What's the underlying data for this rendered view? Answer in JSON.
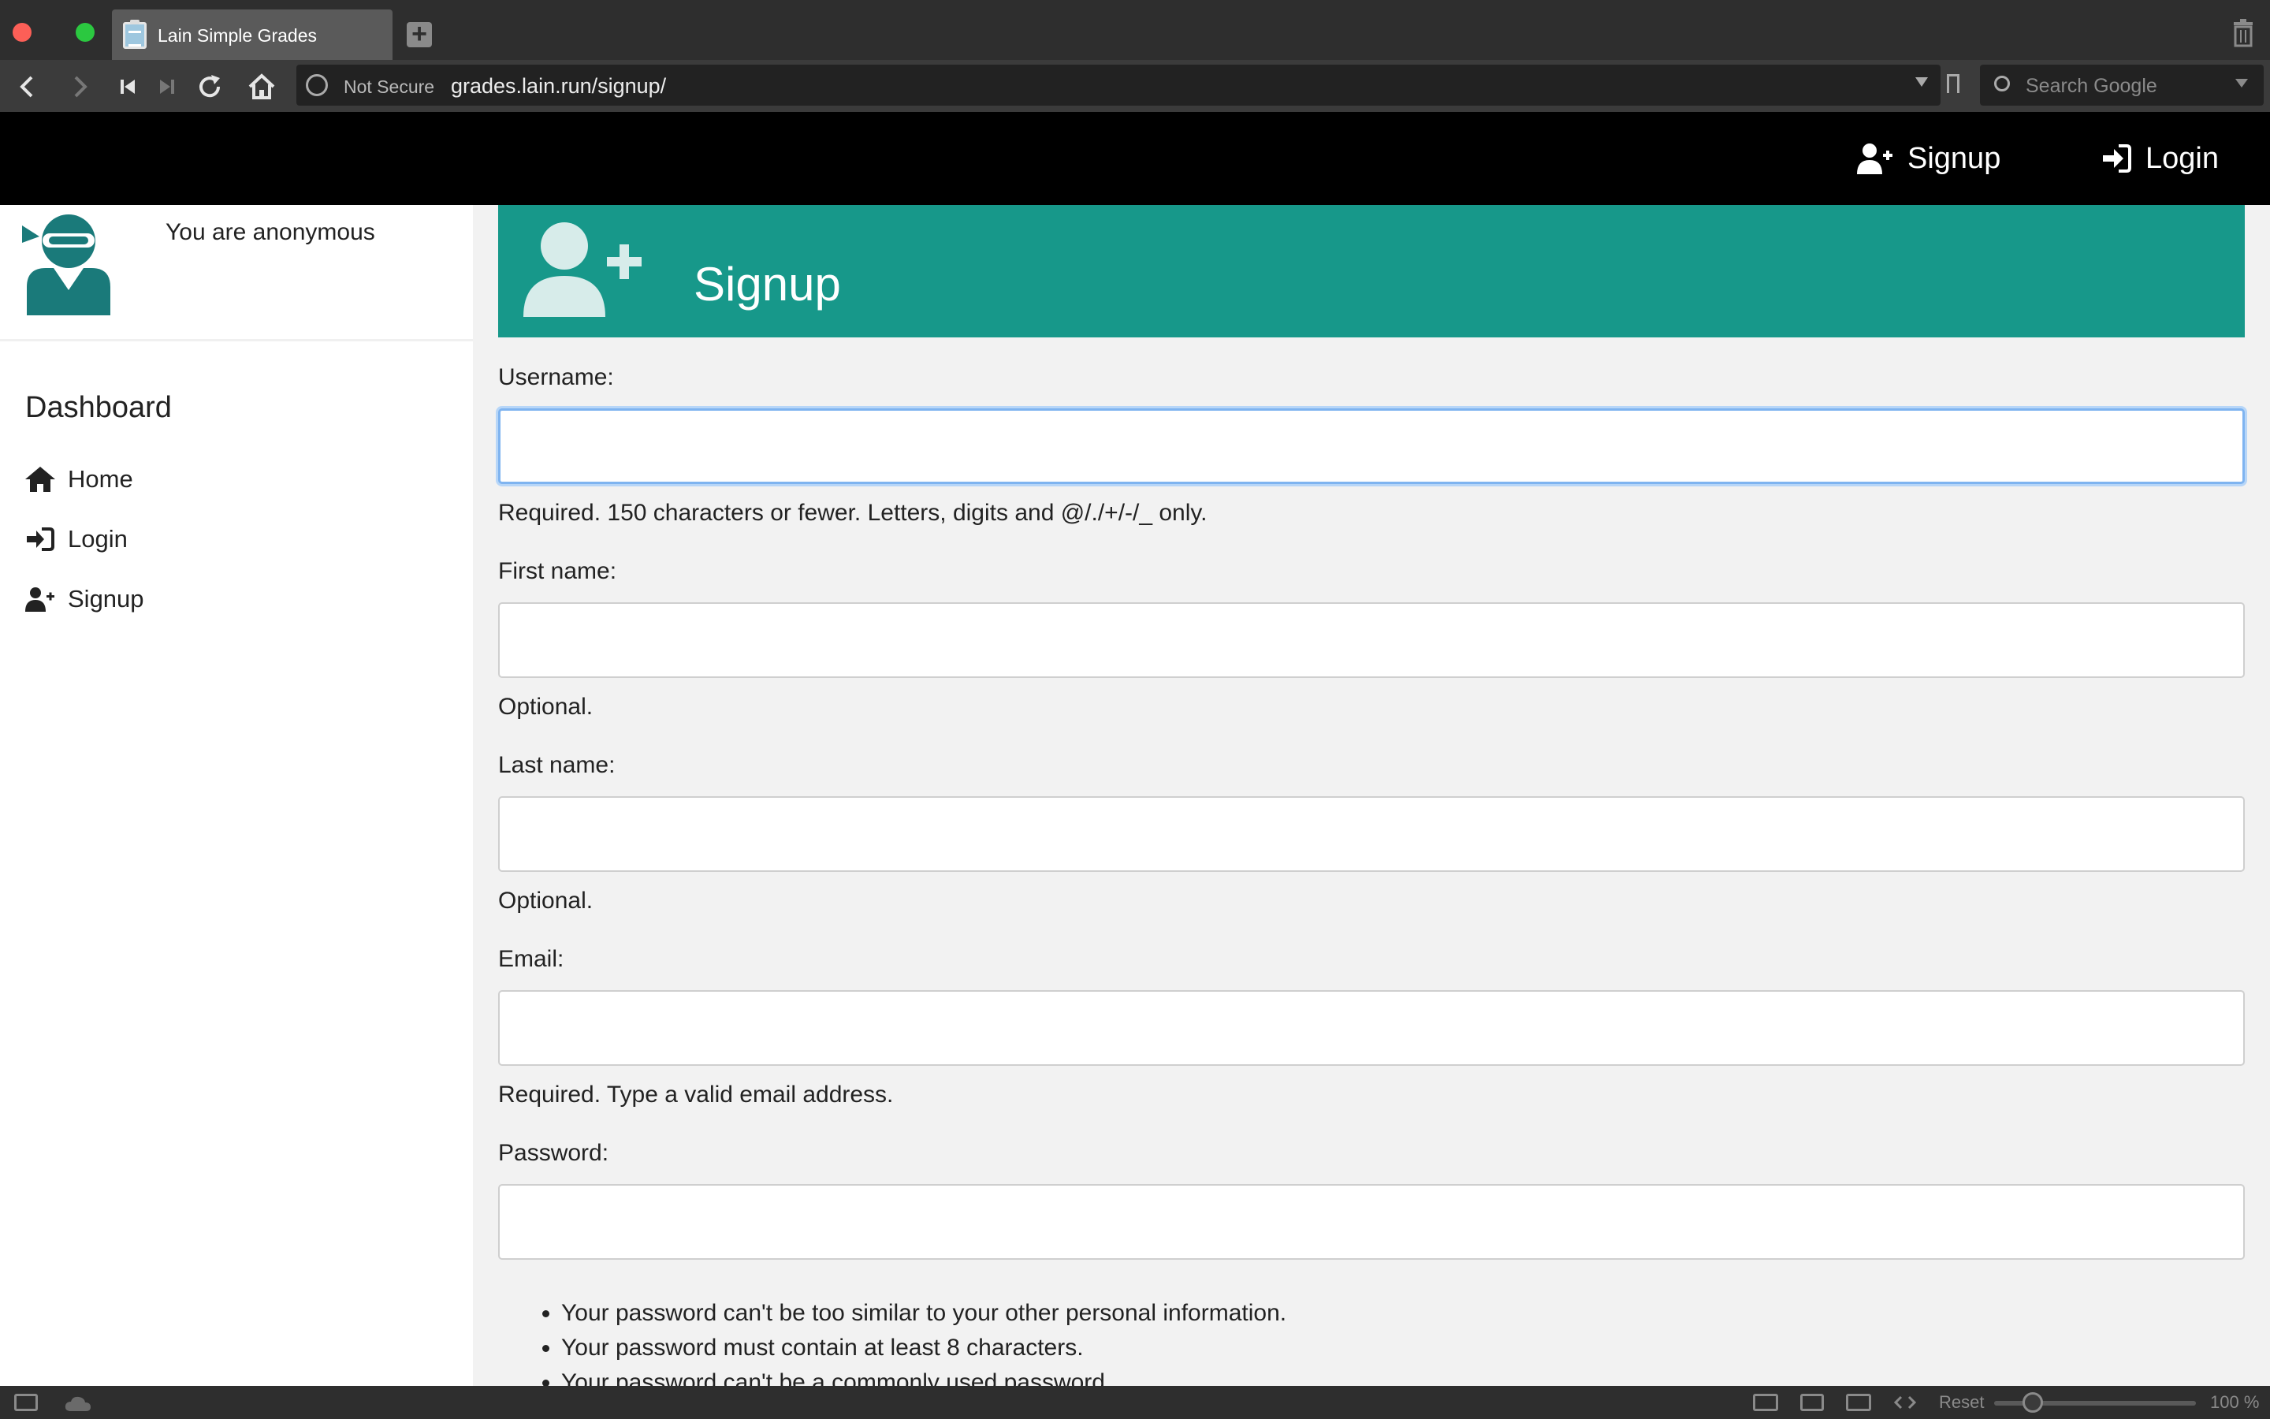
{
  "browser": {
    "tab_title": "Lain Simple Grades",
    "new_tab_label": "+",
    "security_label": "Not Secure",
    "url": "grades.lain.run/signup/",
    "search_placeholder": "Search Google",
    "zoom_reset_label": "Reset",
    "zoom_level": "100 %"
  },
  "header": {
    "signup_label": "Signup",
    "login_label": "Login"
  },
  "sidebar": {
    "user_status": "You are anonymous",
    "section_title": "Dashboard",
    "items": [
      {
        "label": "Home",
        "icon": "home-icon"
      },
      {
        "label": "Login",
        "icon": "sign-in-icon"
      },
      {
        "label": "Signup",
        "icon": "user-plus-icon"
      }
    ]
  },
  "banner": {
    "title": "Signup",
    "icon": "user-plus-icon",
    "color": "#17988a"
  },
  "form": {
    "username": {
      "label": "Username:",
      "value": "",
      "help": "Required. 150 characters or fewer. Letters, digits and @/./+/-/_ only."
    },
    "first_name": {
      "label": "First name:",
      "value": "",
      "help": "Optional."
    },
    "last_name": {
      "label": "Last name:",
      "value": "",
      "help": "Optional."
    },
    "email": {
      "label": "Email:",
      "value": "",
      "help": "Required. Type a valid email address."
    },
    "password": {
      "label": "Password:",
      "value": ""
    },
    "password_rules": [
      "Your password can't be too similar to your other personal information.",
      "Your password must contain at least 8 characters.",
      "Your password can't be a commonly used password."
    ]
  }
}
